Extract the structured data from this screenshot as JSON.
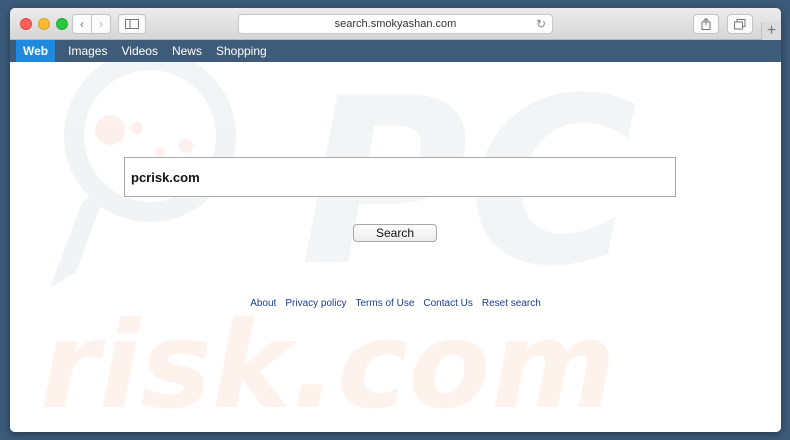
{
  "browser": {
    "url": "search.smokyashan.com",
    "icons": {
      "back": "chevron-left-icon",
      "forward": "chevron-right-icon",
      "sidebar": "sidebar-icon",
      "reload": "reload-icon",
      "share": "share-icon",
      "tabs": "tabs-icon",
      "new_tab": "plus-icon"
    }
  },
  "nav": {
    "items": [
      {
        "label": "Web",
        "active": true
      },
      {
        "label": "Images",
        "active": false
      },
      {
        "label": "Videos",
        "active": false
      },
      {
        "label": "News",
        "active": false
      },
      {
        "label": "Shopping",
        "active": false
      }
    ]
  },
  "search": {
    "value": "pcrisk.com",
    "button_label": "Search"
  },
  "footer": {
    "links": [
      "About",
      "Privacy policy",
      "Terms of Use",
      "Contact Us",
      "Reset search"
    ]
  },
  "watermark": {
    "text_top": "PC",
    "text_bottom": "risk.com"
  },
  "colors": {
    "nav_bar": "#3e5b79",
    "nav_active": "#1e8be0",
    "link": "#1a3d8f"
  }
}
